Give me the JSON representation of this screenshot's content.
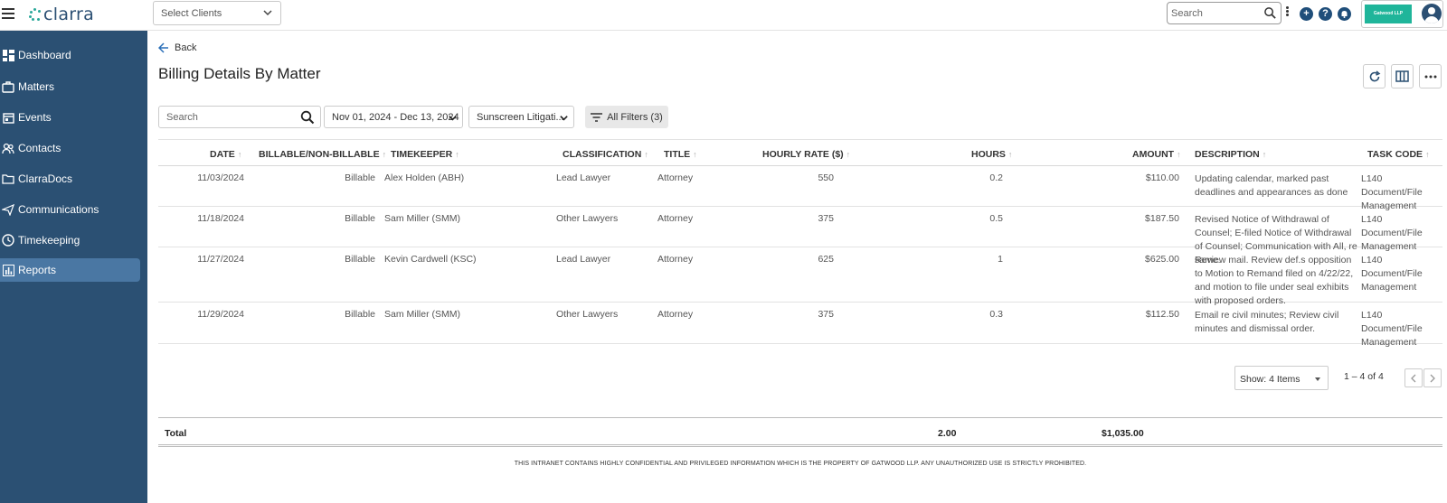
{
  "app": {
    "brand": "clarra"
  },
  "header": {
    "client_select_placeholder": "Select Clients",
    "search_placeholder": "Search",
    "firm_name": "Gatwood LLP",
    "colors": {
      "brand_navy": "#2b5073",
      "firm_badge": "#1fb59a"
    }
  },
  "sidebar": {
    "items": [
      {
        "label": "Dashboard",
        "icon": "dashboard-icon"
      },
      {
        "label": "Matters",
        "icon": "briefcase-icon"
      },
      {
        "label": "Events",
        "icon": "calendar-icon"
      },
      {
        "label": "Contacts",
        "icon": "contacts-icon"
      },
      {
        "label": "ClarraDocs",
        "icon": "folder-icon"
      },
      {
        "label": "Communications",
        "icon": "send-icon"
      },
      {
        "label": "Timekeeping",
        "icon": "clock-icon"
      },
      {
        "label": "Reports",
        "icon": "bar-chart-icon",
        "active": true
      }
    ]
  },
  "page": {
    "back_label": "Back",
    "title": "Billing Details By Matter"
  },
  "filters": {
    "search_placeholder": "Search",
    "date_range": "Nov 01, 2024 - Dec 13, 2024",
    "matter": "Sunscreen Litigati...",
    "all_filters": "All Filters (3)"
  },
  "table": {
    "columns": {
      "date": "DATE",
      "billable": "BILLABLE/NON-BILLABLE",
      "timekeeper": "TIMEKEEPER",
      "classification": "CLASSIFICATION",
      "title": "TITLE",
      "rate": "HOURLY RATE ($)",
      "hours": "HOURS",
      "amount": "AMOUNT",
      "description": "DESCRIPTION",
      "task_code": "TASK CODE"
    },
    "rows": [
      {
        "date": "11/03/2024",
        "billable": "Billable",
        "timekeeper": "Alex Holden (ABH)",
        "classification": "Lead Lawyer",
        "title": "Attorney",
        "rate": "550",
        "hours": "0.2",
        "amount": "$110.00",
        "description": "Updating calendar, marked past deadlines and appearances as done",
        "task_code": "L140 Document/File Management"
      },
      {
        "date": "11/18/2024",
        "billable": "Billable",
        "timekeeper": "Sam Miller (SMM)",
        "classification": "Other Lawyers",
        "title": "Attorney",
        "rate": "375",
        "hours": "0.5",
        "amount": "$187.50",
        "description": "Revised Notice of Withdrawal of Counsel; E-filed Notice of Withdrawal of Counsel; Communication with All, re same.",
        "task_code": "L140 Document/File Management"
      },
      {
        "date": "11/27/2024",
        "billable": "Billable",
        "timekeeper": "Kevin Cardwell (KSC)",
        "classification": "Lead Lawyer",
        "title": "Attorney",
        "rate": "625",
        "hours": "1",
        "amount": "$625.00",
        "description": "Review mail. Review def.s opposition to Motion to Remand filed on 4/22/22, and motion to file under seal exhibits with proposed orders.",
        "task_code": "L140 Document/File Management"
      },
      {
        "date": "11/29/2024",
        "billable": "Billable",
        "timekeeper": "Sam Miller (SMM)",
        "classification": "Other Lawyers",
        "title": "Attorney",
        "rate": "375",
        "hours": "0.3",
        "amount": "$112.50",
        "description": "Email re civil minutes; Review civil minutes and dismissal order.",
        "task_code": "L140 Document/File Management"
      }
    ]
  },
  "pagination": {
    "show_label": "Show: 4 Items",
    "range": "1 – 4 of 4"
  },
  "totals": {
    "label": "Total",
    "hours": "2.00",
    "amount": "$1,035.00"
  },
  "footer": {
    "notice": "THIS INTRANET CONTAINS HIGHLY CONFIDENTIAL AND PRIVILEGED INFORMATION WHICH IS THE PROPERTY OF GATWOOD LLP. ANY UNAUTHORIZED USE IS STRICTLY PROHIBITED."
  }
}
